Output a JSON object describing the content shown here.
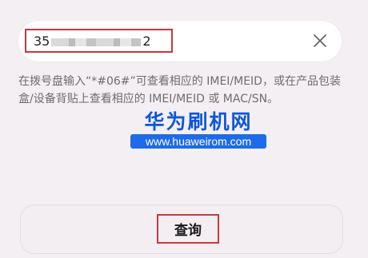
{
  "imei_field": {
    "value_prefix": "35",
    "value_suffix": "2"
  },
  "hint": {
    "text": "在拨号盘输入“*#06#”可查看相应的 IMEI/MEID，或在产品包装盒/设备背贴上查看相应的 IMEI/MEID 或 MAC/SN。"
  },
  "watermark": {
    "title": "华为刷机网",
    "url": "www.huaweirom.com"
  },
  "query_button": {
    "label": "查询"
  },
  "icons": {
    "clear": "close-icon"
  },
  "colors": {
    "highlight_border": "#c8393a",
    "watermark_blue": "#0f57d6",
    "background": "#f3eff3"
  }
}
